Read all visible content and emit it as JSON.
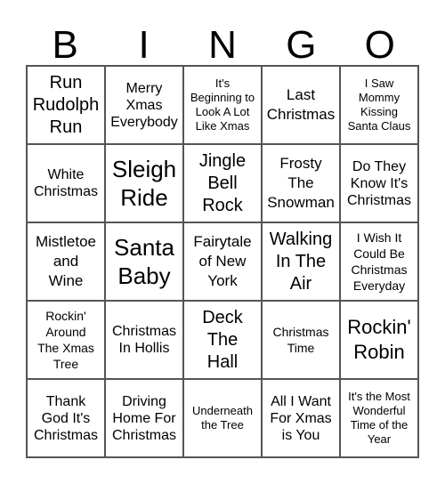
{
  "header": {
    "letters": [
      "B",
      "I",
      "N",
      "G",
      "O"
    ]
  },
  "card": {
    "rows": [
      [
        {
          "text": "Run\nRudolph\nRun"
        },
        {
          "text": "Merry\nXmas\nEverybody"
        },
        {
          "text": "It's\nBeginning to\nLook A Lot\nLike Xmas"
        },
        {
          "text": "Last\nChristmas"
        },
        {
          "text": "I Saw\nMommy\nKissing\nSanta Claus"
        }
      ],
      [
        {
          "text": "White\nChristmas"
        },
        {
          "text": "Sleigh\nRide"
        },
        {
          "text": "Jingle\nBell\nRock"
        },
        {
          "text": "Frosty\nThe\nSnowman"
        },
        {
          "text": "Do They\nKnow It's\nChristmas"
        }
      ],
      [
        {
          "text": "Mistletoe\nand\nWine"
        },
        {
          "text": "Santa\nBaby"
        },
        {
          "text": "Fairytale\nof New\nYork"
        },
        {
          "text": "Walking\nIn The\nAir"
        },
        {
          "text": "I Wish It\nCould Be\nChristmas\nEveryday"
        }
      ],
      [
        {
          "text": "Rockin'\nAround\nThe Xmas\nTree"
        },
        {
          "text": "Christmas\nIn Hollis"
        },
        {
          "text": "Deck\nThe\nHall"
        },
        {
          "text": "Christmas\nTime"
        },
        {
          "text": "Rockin'\nRobin"
        }
      ],
      [
        {
          "text": "Thank\nGod It's\nChristmas"
        },
        {
          "text": "Driving\nHome For\nChristmas"
        },
        {
          "text": "Underneath\nthe Tree"
        },
        {
          "text": "All I Want\nFor Xmas\nis You"
        },
        {
          "text": "It's the Most\nWonderful\nTime of the\nYear"
        }
      ]
    ]
  }
}
